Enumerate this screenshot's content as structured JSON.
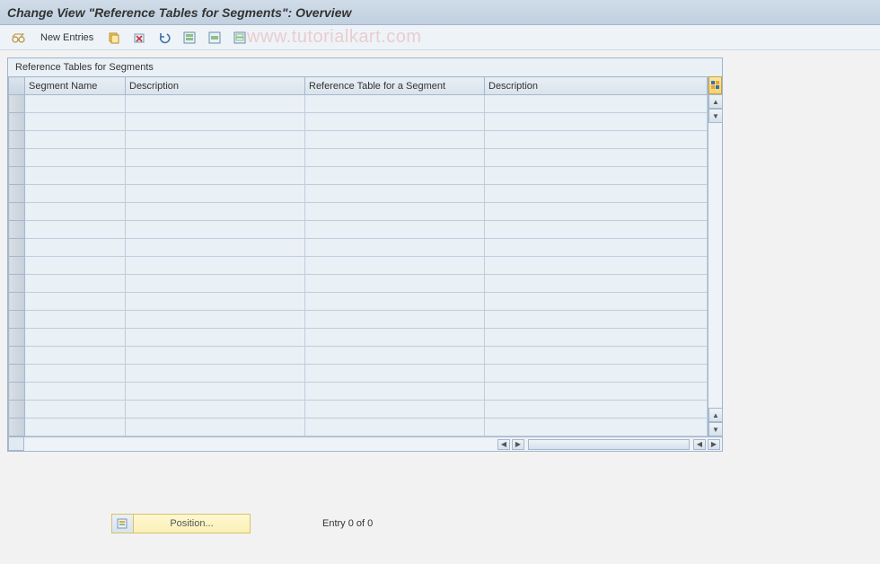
{
  "title": "Change View \"Reference Tables for Segments\": Overview",
  "watermark": "www.tutorialkart.com",
  "toolbar": {
    "new_entries_label": "New Entries"
  },
  "panel": {
    "title": "Reference Tables for Segments",
    "columns": [
      "Segment Name",
      "Description",
      "Reference Table for a Segment",
      "Description"
    ],
    "empty_row_count": 19
  },
  "footer": {
    "position_label": "Position...",
    "entry_text": "Entry 0 of 0"
  }
}
